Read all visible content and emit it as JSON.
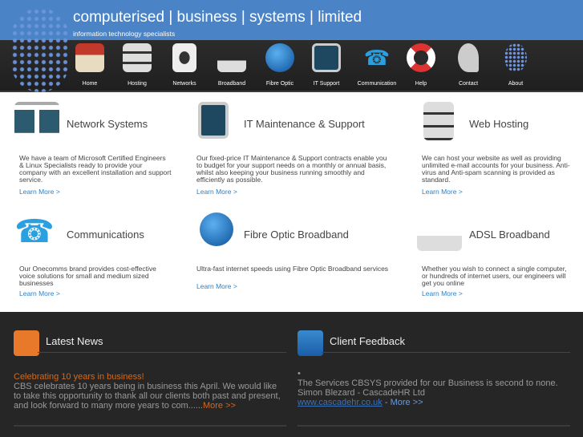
{
  "header": {
    "title": "computerised | business | systems | limited",
    "tagline": "information technology specialists"
  },
  "nav": [
    {
      "label": "Home",
      "icon": "house-icon"
    },
    {
      "label": "Hosting",
      "icon": "server-icon"
    },
    {
      "label": "Networks",
      "icon": "network-socket-icon"
    },
    {
      "label": "Broadband",
      "icon": "router-icon"
    },
    {
      "label": "Fibre Optic",
      "icon": "globe-icon"
    },
    {
      "label": "IT Support",
      "icon": "monitor-pulse-icon"
    },
    {
      "label": "Communication",
      "icon": "phone-icon"
    },
    {
      "label": "Help",
      "icon": "lifebuoy-icon"
    },
    {
      "label": "Contact",
      "icon": "satellite-dish-icon"
    },
    {
      "label": "About",
      "icon": "logo-icon"
    }
  ],
  "services": [
    {
      "title": "Network Systems",
      "desc": "We have a team of Microsoft Certified Engineers & Linux Specialists ready to provide your company with an excellent installation and support service.",
      "link": "Learn More >"
    },
    {
      "title": "IT Maintenance & Support",
      "desc": "Our fixed-price IT Maintenance & Support contracts enable you to budget for your support needs on a monthly or annual basis, whilst also keeping your business running smoothly and efficiently as possible.",
      "link": "Learn More >"
    },
    {
      "title": "Web Hosting",
      "desc": "We can host your website as well as providing unlimited e-mail accounts for your business. Anti-virus and Anti-spam scanning is provided as standard.",
      "link": "Learn More >"
    },
    {
      "title": "Communications",
      "desc": "Our Onecomms brand provides cost-effective voice solutions for small and medium sized businesses",
      "link": "Learn More >"
    },
    {
      "title": "Fibre Optic Broadband",
      "desc": "Ultra-fast internet speeds using Fibre Optic Broadband services",
      "link": "Learn More >"
    },
    {
      "title": "ADSL Broadband",
      "desc": "Whether you wish to connect a single computer, or hundreds of internet users, our engineers will get you online",
      "link": "Learn More >"
    }
  ],
  "news": {
    "title": "Latest News",
    "headline": "Celebrating 10 years in business!",
    "body": "CBS celebrates 10 years being in business this April.  We would like to take this opportunity to thank all our clients both past and present, and look forward to many more years to com......",
    "more": "More >>"
  },
  "feedback": {
    "title": "Client Feedback",
    "bullet": "•",
    "quote": "The Services CBSYS provided for our Business is second to none.",
    "author": "Simon Blezard - CascadeHR Ltd",
    "url": "www.cascadehr.co.uk",
    "sep": " - ",
    "more": "More >>"
  },
  "colors": {
    "header": "#4a84c6",
    "link": "#2a82c9",
    "news_headline": "#d2691e"
  }
}
